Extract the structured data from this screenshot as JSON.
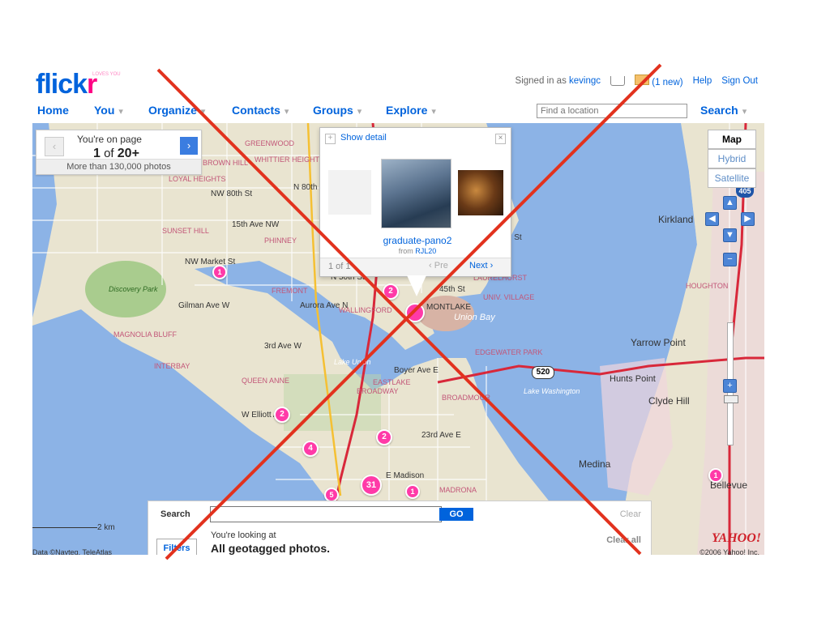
{
  "logo": {
    "brand_left": "flick",
    "brand_right": "r",
    "tagline": "LOVES YOU"
  },
  "topbar": {
    "signed_in_prefix": "Signed in as",
    "username": "kevingc",
    "mail_count": "(1 new)",
    "help": "Help",
    "sign_out": "Sign Out"
  },
  "nav": {
    "items": [
      "Home",
      "You",
      "Organize",
      "Contacts",
      "Groups",
      "Explore"
    ],
    "find_placeholder": "Find a location",
    "search": "Search"
  },
  "pager": {
    "line1": "You're on page",
    "page": "1",
    "of": "of",
    "total": "20+",
    "count_text": "More than 130,000 photos",
    "prev_icon": "‹",
    "next_icon": "›"
  },
  "popup": {
    "show_detail": "Show detail",
    "close_icon": "×",
    "title": "graduate-pano2",
    "from_prefix": "from",
    "owner": "RJL20",
    "count": "1 of 1",
    "prev": "Pre",
    "next": "Next"
  },
  "map_type": {
    "options": [
      "Map",
      "Hybrid",
      "Satellite"
    ],
    "selected": "Map"
  },
  "search_panel": {
    "label": "Search",
    "go": "GO",
    "clear": "Clear",
    "clear_all": "Clear all",
    "filters": "Filters",
    "looking_at": "You're looking at",
    "scope": "All geotagged photos."
  },
  "map": {
    "scale": "2 km",
    "credit": "Data ©Navteq, TeleAtlas",
    "copyright": "©2006 Yahoo! Inc.",
    "yahoo_logo": "YAHOO!",
    "highway_shield": "520",
    "interstate_shield": "405",
    "places": [
      "GREENWOOD",
      "BROWN HILL",
      "WHITTIER HEIGHTS",
      "LOYAL HEIGHTS",
      "NW 80th St",
      "N 80th St",
      "SUNSET HILL",
      "PHINNEY",
      "NW Market St",
      "FREMONT",
      "WALLINGFORD",
      "N 50th St",
      "Discovery Park",
      "MAGNOLIA BLUFF",
      "INTERBAY",
      "QUEEN ANNE",
      "Gilman Ave W",
      "Lake Union",
      "EASTLAKE",
      "BROADWAY",
      "Union Bay",
      "UNIV. VILLAGE",
      "LAURELHURST",
      "Kirkland",
      "Yarrow Point",
      "Hunts Point",
      "Clyde Hill",
      "Medina",
      "Bellevue",
      "Lake Washington",
      "BROADMOOR",
      "MADRONA",
      "HOUGHTON",
      "MONTLAKE",
      "E Madison",
      "65th St",
      "45th St",
      "23rd Ave E",
      "Aurora Ave N",
      "15th Ave NW",
      "3rd Ave W",
      "W Elliott Ave",
      "Boyer Ave E",
      "EDGEWATER PARK"
    ],
    "markers": [
      "1",
      "2",
      "2",
      "2",
      "4",
      "31",
      "5",
      "1",
      "1"
    ]
  },
  "overlay": {
    "cross_color": "#e2321e"
  }
}
